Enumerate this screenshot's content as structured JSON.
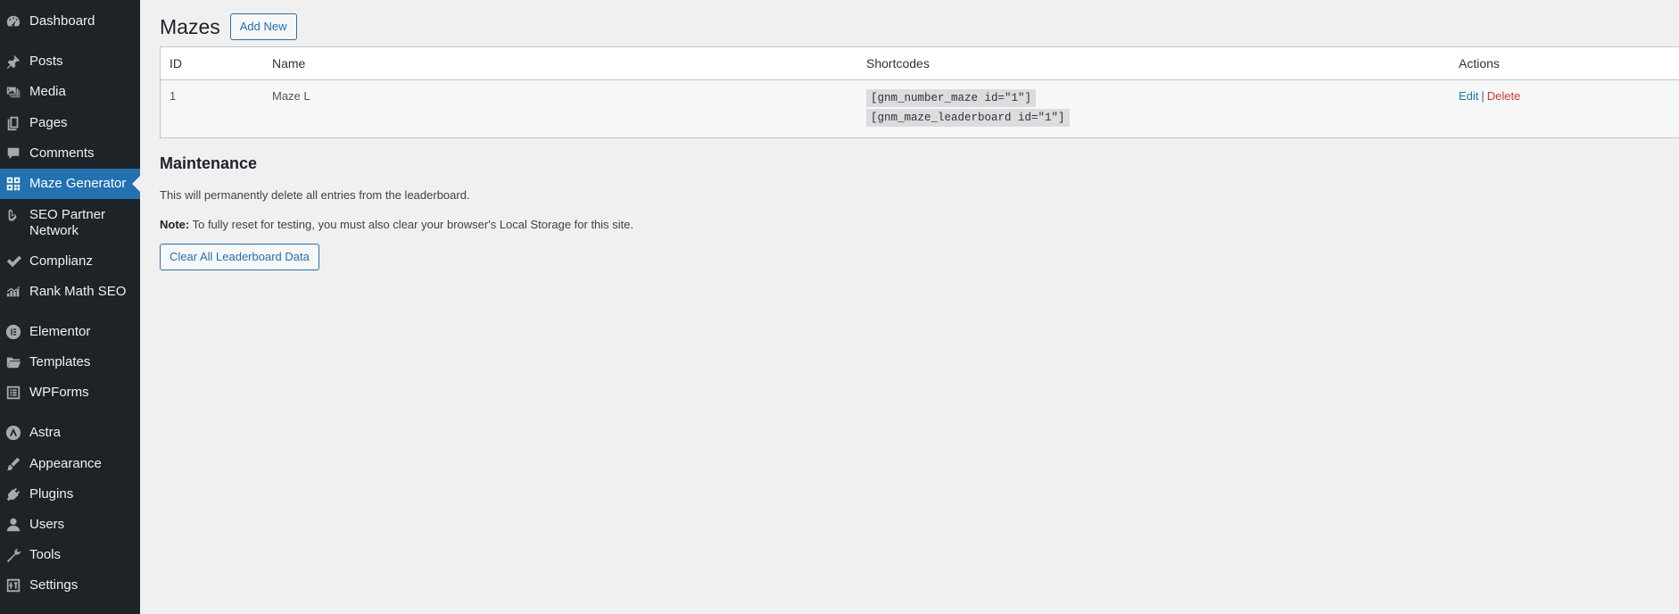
{
  "sidebar": {
    "items": [
      {
        "label": "Dashboard",
        "icon": "dashboard-icon"
      },
      {
        "label": "Posts",
        "icon": "pin-icon"
      },
      {
        "label": "Media",
        "icon": "media-icon"
      },
      {
        "label": "Pages",
        "icon": "pages-icon"
      },
      {
        "label": "Comments",
        "icon": "comment-icon"
      },
      {
        "label": "Maze Generator",
        "icon": "grid-icon",
        "current": true
      },
      {
        "label": "SEO Partner Network",
        "icon": "leaf-icon"
      },
      {
        "label": "Complianz",
        "icon": "check-icon"
      },
      {
        "label": "Rank Math SEO",
        "icon": "chart-icon"
      },
      {
        "label": "Elementor",
        "icon": "elementor-icon"
      },
      {
        "label": "Templates",
        "icon": "folder-icon"
      },
      {
        "label": "WPForms",
        "icon": "forms-icon"
      },
      {
        "label": "Astra",
        "icon": "astra-icon"
      },
      {
        "label": "Appearance",
        "icon": "brush-icon"
      },
      {
        "label": "Plugins",
        "icon": "plug-icon"
      },
      {
        "label": "Users",
        "icon": "user-icon"
      },
      {
        "label": "Tools",
        "icon": "wrench-icon"
      },
      {
        "label": "Settings",
        "icon": "settings-icon"
      }
    ]
  },
  "page": {
    "title": "Mazes",
    "add_new": "Add New"
  },
  "table": {
    "headers": {
      "id": "ID",
      "name": "Name",
      "shortcodes": "Shortcodes",
      "actions": "Actions"
    },
    "rows": [
      {
        "id": "1",
        "name": "Maze L",
        "shortcode_1": "[gnm_number_maze id=\"1\"]",
        "shortcode_2": "[gnm_maze_leaderboard id=\"1\"]",
        "edit": "Edit",
        "separator": "|",
        "delete": "Delete"
      }
    ]
  },
  "maintenance": {
    "title": "Maintenance",
    "description": "This will permanently delete all entries from the leaderboard.",
    "note_label": "Note:",
    "note_text": " To fully reset for testing, you must also clear your browser's Local Storage for this site.",
    "clear_button": "Clear All Leaderboard Data"
  },
  "colors": {
    "sidebar_bg": "#1d2327",
    "accent": "#2271b1",
    "delete": "#d63638",
    "page_bg": "#f0f0f1"
  }
}
